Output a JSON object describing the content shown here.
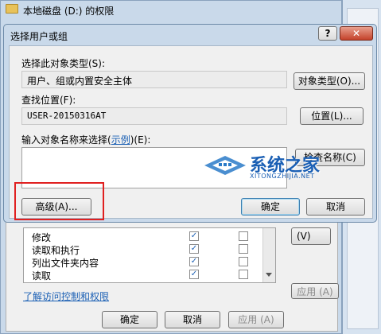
{
  "bg_window": {
    "title": "本地磁盘 (D:) 的权限",
    "permissions": [
      {
        "name": "修改",
        "allow": true,
        "deny": false
      },
      {
        "name": "读取和执行",
        "allow": true,
        "deny": false
      },
      {
        "name": "列出文件夹内容",
        "allow": true,
        "deny": false
      },
      {
        "name": "读取",
        "allow": true,
        "deny": false
      }
    ],
    "link": "了解访问控制和权限",
    "ok": "确定",
    "cancel": "取消",
    "apply": "应用 (A)",
    "right_btn_1": "(V)",
    "right_btn_2": "应用 (A)"
  },
  "dialog": {
    "title": "选择用户或组",
    "help_icon": "help-icon",
    "close_icon": "close-icon",
    "object_type_label": "选择此对象类型(S):",
    "object_type_value": "用户、组或内置安全主体",
    "object_type_button": "对象类型(O)...",
    "location_label": "查找位置(F):",
    "location_value": "USER-20150316AT",
    "location_button": "位置(L)...",
    "enter_names_prefix": "输入对象名称来选择(",
    "enter_names_link": "示例",
    "enter_names_suffix": ")(E):",
    "names_value": "",
    "check_names_button": "检查名称(C)",
    "advanced_button": "高级(A)...",
    "ok_button": "确定",
    "cancel_button": "取消"
  },
  "watermark": {
    "title": "系统之家",
    "subtitle": "XITONGZHIJIA.NET"
  },
  "colors": {
    "highlight_red": "#e02020",
    "title_bar": "#c9d9ea",
    "link_blue": "#1a5fb4"
  }
}
